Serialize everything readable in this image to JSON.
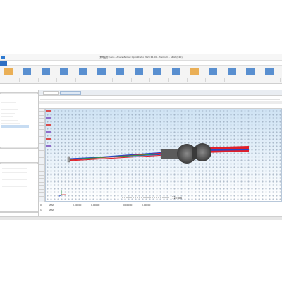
{
  "window": {
    "title": "未命名的 (Lens - Ansys Zemax OpticStudio 2023 R1.00 - Premium - 64bit (R10)"
  },
  "ribbon": {
    "groups": [
      {
        "id": "g1",
        "accent": "#e8a23a"
      },
      {
        "id": "g2",
        "accent": "#3d7cc9"
      },
      {
        "id": "g3",
        "accent": "#3d7cc9"
      },
      {
        "id": "g4",
        "accent": "#3d7cc9"
      },
      {
        "id": "g5",
        "accent": "#3d7cc9"
      },
      {
        "id": "g6",
        "accent": "#3d7cc9"
      },
      {
        "id": "g7",
        "accent": "#3d7cc9"
      },
      {
        "id": "g8",
        "accent": "#3d7cc9"
      },
      {
        "id": "g9",
        "accent": "#3d7cc9"
      },
      {
        "id": "g10",
        "accent": "#3d7cc9"
      },
      {
        "id": "g11",
        "accent": "#e8a23a"
      },
      {
        "id": "g12",
        "accent": "#3d7cc9"
      },
      {
        "id": "g13",
        "accent": "#3d7cc9"
      },
      {
        "id": "g14",
        "accent": "#3d7cc9"
      },
      {
        "id": "g15",
        "accent": "#3d7cc9"
      }
    ]
  },
  "layout_window": {
    "scale_label": "72 mm",
    "background_top": "#cfe3f4",
    "background_bottom": "#ffffff"
  },
  "lens_data": {
    "rows": [
      {
        "surface": "0",
        "type": "STAN"
      },
      {
        "surface": "1",
        "type": "STAN"
      }
    ],
    "cells": [
      "0.00000",
      "0.00000",
      "0.00000",
      "0.00000"
    ]
  },
  "colors": {
    "ray_blue": "#2446c8",
    "ray_red": "#e0202a",
    "side_highlight": "#1f6fd1",
    "row_marker": "#d94b4b",
    "row_marker_alt": "#8f6cc9"
  }
}
